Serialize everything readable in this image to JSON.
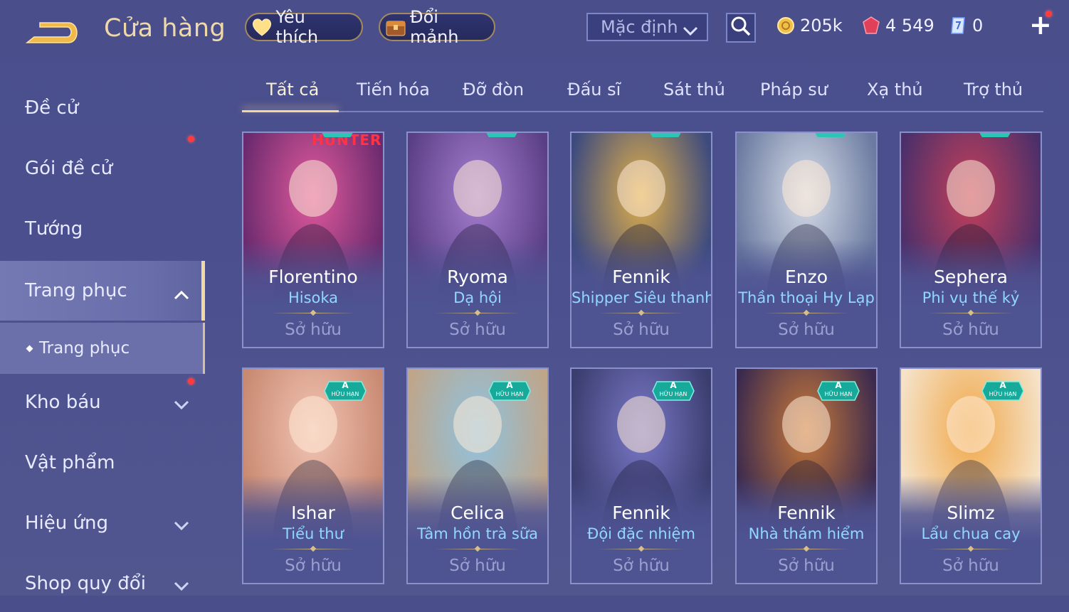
{
  "header": {
    "title": "Cửa hàng",
    "favorites_label": "Yêu thích",
    "exchange_label": "Đổi mảnh",
    "sort_value": "Mặc định",
    "gold": "205k",
    "gems": "4 549",
    "vouchers": "0",
    "plus": "+"
  },
  "sidebar": {
    "items": [
      {
        "label": "Đề cử"
      },
      {
        "label": "Gói đề cử"
      },
      {
        "label": "Tướng"
      },
      {
        "label": "Trang phục"
      },
      {
        "label": "Trang phục"
      },
      {
        "label": "Kho báu"
      },
      {
        "label": "Vật phẩm"
      },
      {
        "label": "Hiệu ứng"
      },
      {
        "label": "Shop quy đổi"
      }
    ]
  },
  "tabs": [
    "Tất cả",
    "Tiến hóa",
    "Đỡ đòn",
    "Đấu sĩ",
    "Sát thủ",
    "Pháp sư",
    "Xạ thủ",
    "Trợ thủ"
  ],
  "cards": [
    {
      "hero": "Florentino",
      "skin": "Hisoka",
      "status": "Sở hữu",
      "art_text": "HUNTER",
      "palette": [
        "#e05a9c",
        "#6c2a6e"
      ]
    },
    {
      "hero": "Ryoma",
      "skin": "Dạ hội",
      "status": "Sở hữu",
      "palette": [
        "#a67fd0",
        "#5b3f85"
      ]
    },
    {
      "hero": "Fennik",
      "skin": "Shipper Siêu thanh",
      "status": "Sở hữu",
      "palette": [
        "#e2b04a",
        "#3c4a7e"
      ]
    },
    {
      "hero": "Enzo",
      "skin": "Thần thoại Hy Lạp",
      "status": "Sở hữu",
      "palette": [
        "#d7dde8",
        "#6a7aa0"
      ]
    },
    {
      "hero": "Sephera",
      "skin": "Phi vụ thế kỷ",
      "status": "Sở hữu",
      "palette": [
        "#c6405a",
        "#4b2f6a"
      ]
    },
    {
      "hero": "Ishar",
      "skin": "Tiểu thư",
      "status": "Sở hữu",
      "badge_grade": "A",
      "badge_text": "HỮU HẠN",
      "palette": [
        "#f1c4b4",
        "#c98a72"
      ]
    },
    {
      "hero": "Celica",
      "skin": "Tâm hồn trà sữa",
      "status": "Sở hữu",
      "badge_grade": "A",
      "badge_text": "HỮU HẠN",
      "palette": [
        "#8fc3e0",
        "#bfa58a"
      ]
    },
    {
      "hero": "Fennik",
      "skin": "Đội đặc nhiệm",
      "status": "Sở hữu",
      "badge_grade": "A",
      "badge_text": "HỮU HẠN",
      "palette": [
        "#7a78c8",
        "#3a3d6e"
      ]
    },
    {
      "hero": "Fennik",
      "skin": "Nhà thám hiểm",
      "status": "Sở hữu",
      "badge_grade": "A",
      "badge_text": "HỮU HẠN",
      "palette": [
        "#c97a3a",
        "#3c2a4e"
      ]
    },
    {
      "hero": "Slimz",
      "skin": "Lẩu chua cay",
      "status": "Sở hữu",
      "badge_grade": "A",
      "badge_text": "HỮU HẠN",
      "palette": [
        "#f0a84a",
        "#f5e2c8"
      ]
    }
  ],
  "colors": {
    "accent": "#f0d7a0",
    "skin_text": "#8fd9ff",
    "notify": "#ff3b3b"
  }
}
